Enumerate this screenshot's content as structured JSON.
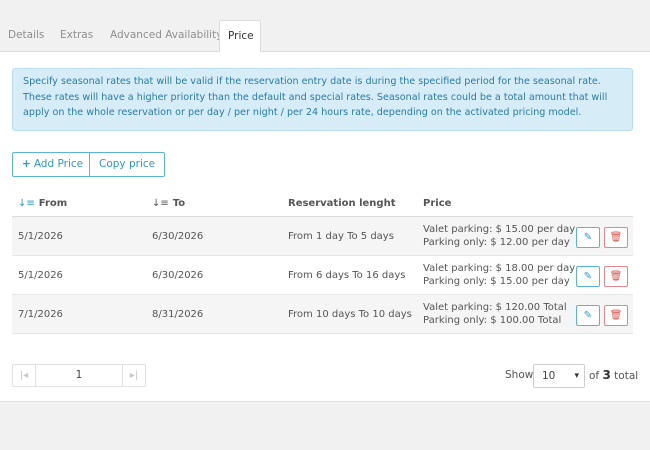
{
  "tabs": [
    {
      "label": "Details"
    },
    {
      "label": "Extras"
    },
    {
      "label": "Advanced Availability"
    },
    {
      "label": "Price",
      "active": true
    }
  ],
  "info": {
    "text": "Specify seasonal rates that will be valid if the reservation entry date is during the specified period for the seasonal rate. These rates will have a higher priority than the default and special rates. Seasonal rates could be a total amount that will apply on the whole reservation or per day / per night / per 24 hours rate, depending on the activated pricing model."
  },
  "toolbar": {
    "add_label": "Add Price",
    "copy_label": "Copy price"
  },
  "table": {
    "columns": [
      "From",
      "To",
      "Reservation lenght",
      "Price"
    ],
    "rows": [
      {
        "from": "5/1/2026",
        "to": "6/30/2026",
        "length": "From 1 day To 5 days",
        "price_line1": "Valet parking: $ 15.00 per day",
        "price_line2": "Parking only: $ 12.00 per day"
      },
      {
        "from": "5/1/2026",
        "to": "6/30/2026",
        "length": "From 6 days To 16 days",
        "price_line1": "Valet parking: $ 18.00 per day",
        "price_line2": "Parking only: $ 15.00 per day"
      },
      {
        "from": "7/1/2026",
        "to": "8/31/2026",
        "length": "From 10 days To 10 days",
        "price_line1": "Valet parking: $ 120.00 Total",
        "price_line2": "Parking only: $ 100.00 Total"
      }
    ]
  },
  "pagination": {
    "page": "1",
    "show_label": "Show",
    "page_size": "10",
    "of_label": "of",
    "total": "3",
    "total_label": "total"
  },
  "icons": {
    "first": "first-page-icon",
    "last": "last-page-icon",
    "sort": "sort-asc-icon",
    "edit": "pencil-icon",
    "delete": "trash-icon"
  },
  "colors": {
    "accent": "#2e97c6",
    "info_bg": "#d6ecf6",
    "danger": "#d9534f"
  }
}
